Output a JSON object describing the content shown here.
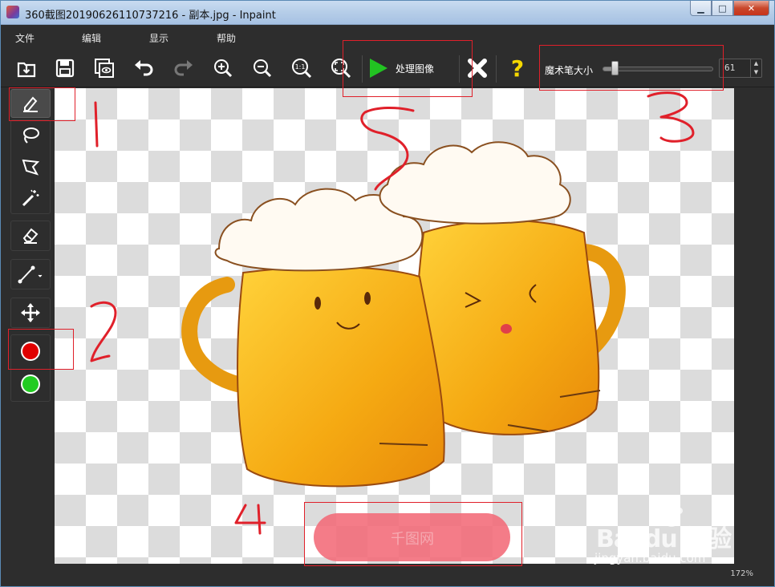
{
  "window": {
    "title": "360截图20190626110737216 - 副本.jpg - Inpaint",
    "buttons": {
      "minimize": "▁",
      "maximize": "□",
      "close": "✕"
    }
  },
  "menu": {
    "items": [
      {
        "label": "文件"
      },
      {
        "label": "编辑"
      },
      {
        "label": "显示"
      },
      {
        "label": "帮助"
      }
    ]
  },
  "toolbar": {
    "icons": [
      "open-icon",
      "save-icon",
      "preview-icon",
      "undo-icon",
      "redo-icon",
      "zoom-in-icon",
      "zoom-out-icon",
      "actual-size-icon",
      "fit-screen-icon"
    ],
    "actual_size_text": "1:1",
    "process_label": "处理图像",
    "cancel_icon": "close-x-icon",
    "help_glyph": "?",
    "wand_size_label": "魔术笔大小",
    "wand_size_value": "61",
    "wand_size_fraction": 0.09
  },
  "tools": {
    "items": [
      "marker-icon",
      "lasso-icon",
      "polygon-lasso-icon",
      "magic-wand-icon",
      "eraser-icon",
      "line-icon",
      "move-icon",
      "red-color-icon",
      "green-color-icon"
    ],
    "red_color": "#e00000",
    "green_color": "#22cc22"
  },
  "status": {
    "zoom": "172%"
  },
  "watermark": {
    "logo": "Bai du 经验",
    "url": "jingyan.baidu.com"
  },
  "canvas_watermark": {
    "text": "千图网"
  },
  "annotations": {
    "handwritten": [
      "1",
      "2",
      "3",
      "4",
      "5"
    ],
    "color": "#e0202a"
  }
}
